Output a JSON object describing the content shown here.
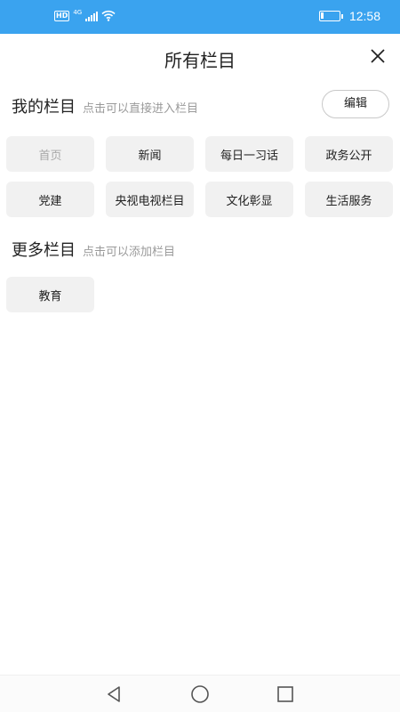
{
  "status_bar": {
    "hd_badge": "HD",
    "network": "4G",
    "time": "12:58",
    "battery_level": 0.15,
    "icons": [
      "hd-icon",
      "signal-icon",
      "wifi-icon",
      "battery-icon"
    ]
  },
  "header": {
    "title": "所有栏目",
    "close_icon": "close-icon"
  },
  "my_channels": {
    "title": "我的栏目",
    "hint": "点击可以直接进入栏目",
    "edit_label": "编辑",
    "items": [
      {
        "label": "首页",
        "disabled": true
      },
      {
        "label": "新闻"
      },
      {
        "label": "每日一习话"
      },
      {
        "label": "政务公开"
      },
      {
        "label": "党建"
      },
      {
        "label": "央视电视栏目"
      },
      {
        "label": "文化彰显"
      },
      {
        "label": "生活服务"
      }
    ]
  },
  "more_channels": {
    "title": "更多栏目",
    "hint": "点击可以添加栏目",
    "items": [
      {
        "label": "教育"
      }
    ]
  },
  "nav_bar": {
    "buttons": [
      "back-icon",
      "home-icon",
      "recents-icon"
    ]
  },
  "colors": {
    "status_bar_bg": "#3aa3ef",
    "tile_bg": "#f1f1f1",
    "hint_text": "#9a9a9a",
    "disabled_text": "#a8a8a8"
  }
}
